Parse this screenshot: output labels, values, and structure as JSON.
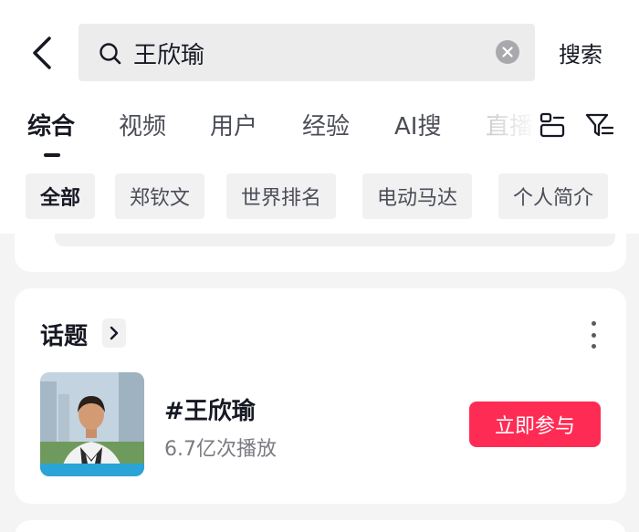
{
  "search": {
    "query": "王欣瑜",
    "submit_label": "搜索"
  },
  "tabs": [
    {
      "label": "综合"
    },
    {
      "label": "视频"
    },
    {
      "label": "用户"
    },
    {
      "label": "经验"
    },
    {
      "label": "AI搜"
    },
    {
      "label": "直播"
    }
  ],
  "chips": [
    {
      "label": "全部"
    },
    {
      "label": "郑钦文"
    },
    {
      "label": "世界排名"
    },
    {
      "label": "电动马达"
    },
    {
      "label": "个人简介"
    }
  ],
  "topic_card": {
    "title": "话题",
    "topic_name": "#王欣瑜",
    "views": "6.7亿次播放",
    "join_label": "立即参与"
  },
  "colors": {
    "accent": "#fe2c55",
    "text_primary": "#161823",
    "text_secondary": "#7b7c82",
    "page_bg": "#f4f4f4"
  },
  "icons": [
    "back-arrow-icon",
    "search-icon",
    "clear-icon",
    "layout-icon",
    "filter-icon",
    "chevron-right-icon",
    "more-vertical-icon"
  ]
}
